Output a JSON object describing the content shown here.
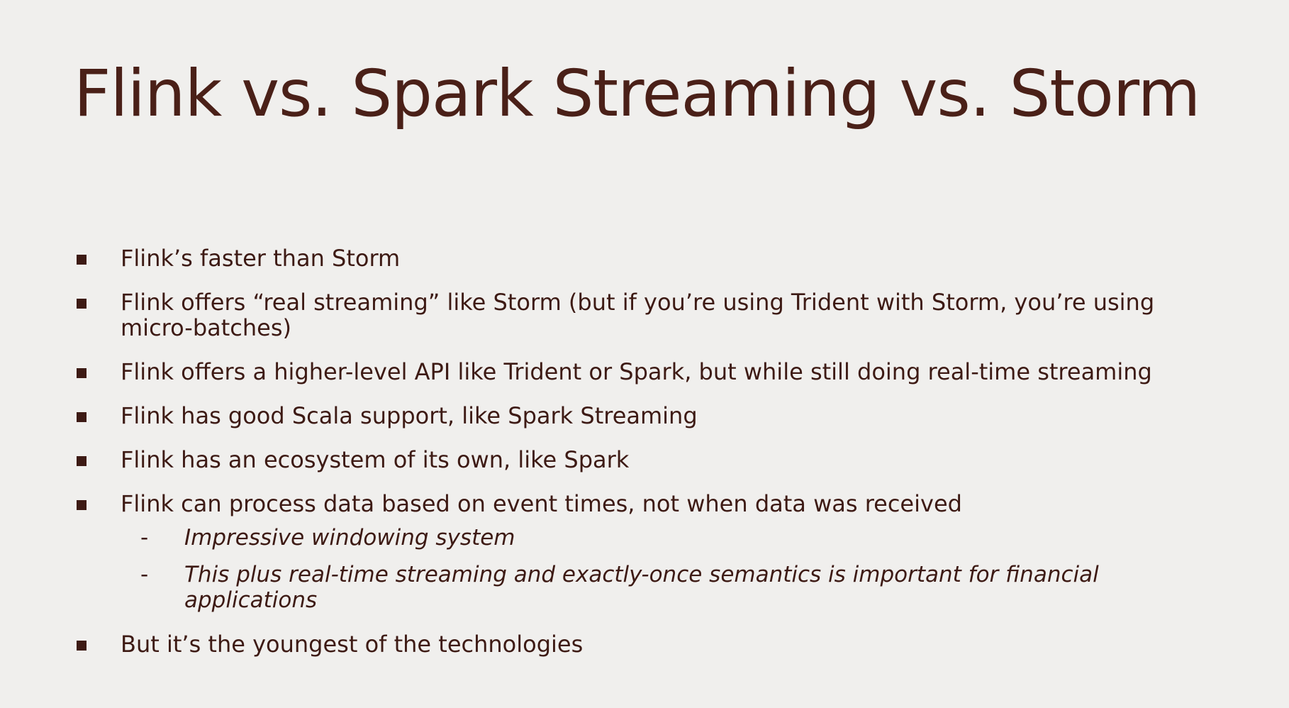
{
  "slide": {
    "title": "Flink vs. Spark Streaming vs. Storm",
    "bullets": [
      {
        "text": "Flink’s faster than Storm"
      },
      {
        "text": "Flink offers “real streaming” like Storm (but if you’re using Trident with Storm, you’re using micro-batches)"
      },
      {
        "text": "Flink offers a higher-level API like Trident or Spark, but while still doing real-time streaming"
      },
      {
        "text": "Flink has good Scala support, like Spark Streaming"
      },
      {
        "text": "Flink has an ecosystem of its own, like Spark"
      },
      {
        "text": "Flink can process data based on event times, not when data was received",
        "sub": [
          {
            "marker": "-",
            "text": "Impressive windowing system"
          },
          {
            "marker": "-",
            "text": "This plus real-time streaming and exactly-once semantics is important for financial applications"
          }
        ]
      },
      {
        "text": "But it’s the youngest of the technologies"
      }
    ]
  },
  "colors": {
    "background": "#f0efed",
    "text": "#4a2018"
  }
}
